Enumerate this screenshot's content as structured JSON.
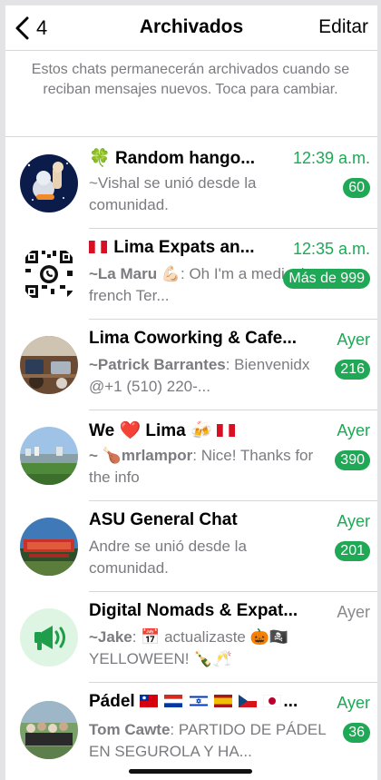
{
  "header": {
    "back_count": "4",
    "title": "Archivados",
    "edit_label": "Editar"
  },
  "info_text": "Estos chats permanecerán archivados cuando se reciban mensajes nuevos. Toca para cambiar.",
  "chats": [
    {
      "name_emoji": "🍀",
      "name": "Random hango...",
      "time": "12:39 a.m.",
      "message": "~Vishal se unió desde la comunidad.",
      "badge": "60"
    },
    {
      "name": "Lima Expats an...",
      "time": "12:35 a.m.",
      "sender": "~La Maru",
      "sender_emoji": "💪🏻",
      "message": ": Oh I'm a medical french Ter...",
      "badge": "Más de 999"
    },
    {
      "name": "Lima Coworking & Cafe...",
      "time": "Ayer",
      "sender": "~Patrick Barrantes",
      "message": ": Bienvenidx @+1 (510) 220-...",
      "badge": "216"
    },
    {
      "name": "We",
      "name_suffix": "Lima",
      "heart": "❤️",
      "cheers": "🍻",
      "time": "Ayer",
      "sender_prefix": "~",
      "sender_emoji": "🍗",
      "sender": "mrlampor",
      "message": ": Nice!  Thanks for the info",
      "badge": "390"
    },
    {
      "name": "ASU General Chat",
      "time": "Ayer",
      "message": "Andre se unió desde la comunidad.",
      "badge": "201"
    },
    {
      "name": "Digital Nomads & Expat...",
      "time": "Ayer",
      "sender": "~Jake",
      "message_part1": ": ",
      "calendar_emoji": "📅",
      "message_part2": " actualizaste ",
      "pumpkin": "🎃",
      "pirate": "🏴‍☠️",
      "message_part3": " YELLOWEEN! ",
      "bottle": "🍾",
      "glasses": "🥂"
    },
    {
      "name": "Pádel",
      "name_ellipsis": "...",
      "time": "Ayer",
      "sender": "Tom Cawte",
      "message": ": PARTIDO DE PÁDEL EN SEGUROLA Y HA...",
      "badge": "36"
    }
  ],
  "icons": {
    "back": "chevron-left-icon",
    "megaphone": "megaphone-icon"
  },
  "colors": {
    "accent_green": "#1fa855",
    "secondary_text": "#7b7b80"
  }
}
